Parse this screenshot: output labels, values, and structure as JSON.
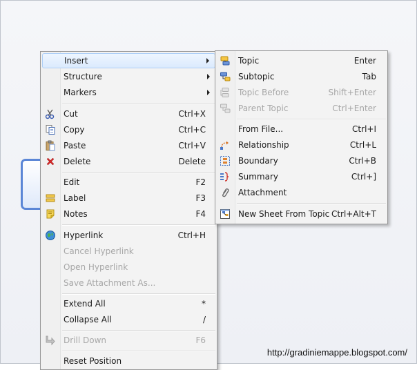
{
  "main_menu": {
    "insert": {
      "label": "Insert"
    },
    "structure": {
      "label": "Structure"
    },
    "markers": {
      "label": "Markers"
    },
    "cut": {
      "label": "Cut",
      "shortcut": "Ctrl+X"
    },
    "copy": {
      "label": "Copy",
      "shortcut": "Ctrl+C"
    },
    "paste": {
      "label": "Paste",
      "shortcut": "Ctrl+V"
    },
    "delete": {
      "label": "Delete",
      "shortcut": "Delete"
    },
    "edit": {
      "label": "Edit",
      "shortcut": "F2"
    },
    "label": {
      "label": "Label",
      "shortcut": "F3"
    },
    "notes": {
      "label": "Notes",
      "shortcut": "F4"
    },
    "hyperlink": {
      "label": "Hyperlink",
      "shortcut": "Ctrl+H"
    },
    "cancel_hyperlink": {
      "label": "Cancel Hyperlink"
    },
    "open_hyperlink": {
      "label": "Open Hyperlink"
    },
    "save_attachment_as": {
      "label": "Save Attachment As..."
    },
    "extend_all": {
      "label": "Extend All",
      "shortcut": "*"
    },
    "collapse_all": {
      "label": "Collapse All",
      "shortcut": "/"
    },
    "drill_down": {
      "label": "Drill Down",
      "shortcut": "F6"
    },
    "reset_position": {
      "label": "Reset Position"
    }
  },
  "insert_submenu": {
    "topic": {
      "label": "Topic",
      "shortcut": "Enter"
    },
    "subtopic": {
      "label": "Subtopic",
      "shortcut": "Tab"
    },
    "topic_before": {
      "label": "Topic Before",
      "shortcut": "Shift+Enter"
    },
    "parent_topic": {
      "label": "Parent Topic",
      "shortcut": "Ctrl+Enter"
    },
    "from_file": {
      "label": "From File...",
      "shortcut": "Ctrl+I"
    },
    "relationship": {
      "label": "Relationship",
      "shortcut": "Ctrl+L"
    },
    "boundary": {
      "label": "Boundary",
      "shortcut": "Ctrl+B"
    },
    "summary": {
      "label": "Summary",
      "shortcut": "Ctrl+]"
    },
    "attachment": {
      "label": "Attachment"
    },
    "new_sheet_from_topic": {
      "label": "New Sheet From Topic",
      "shortcut": "Ctrl+Alt+T"
    }
  },
  "watermark": "http://gradiniemappe.blogspot.com/",
  "colors": {
    "highlight": "#dbeafd",
    "node_border": "#5b86d6",
    "disabled_text": "#a7a7a7"
  }
}
